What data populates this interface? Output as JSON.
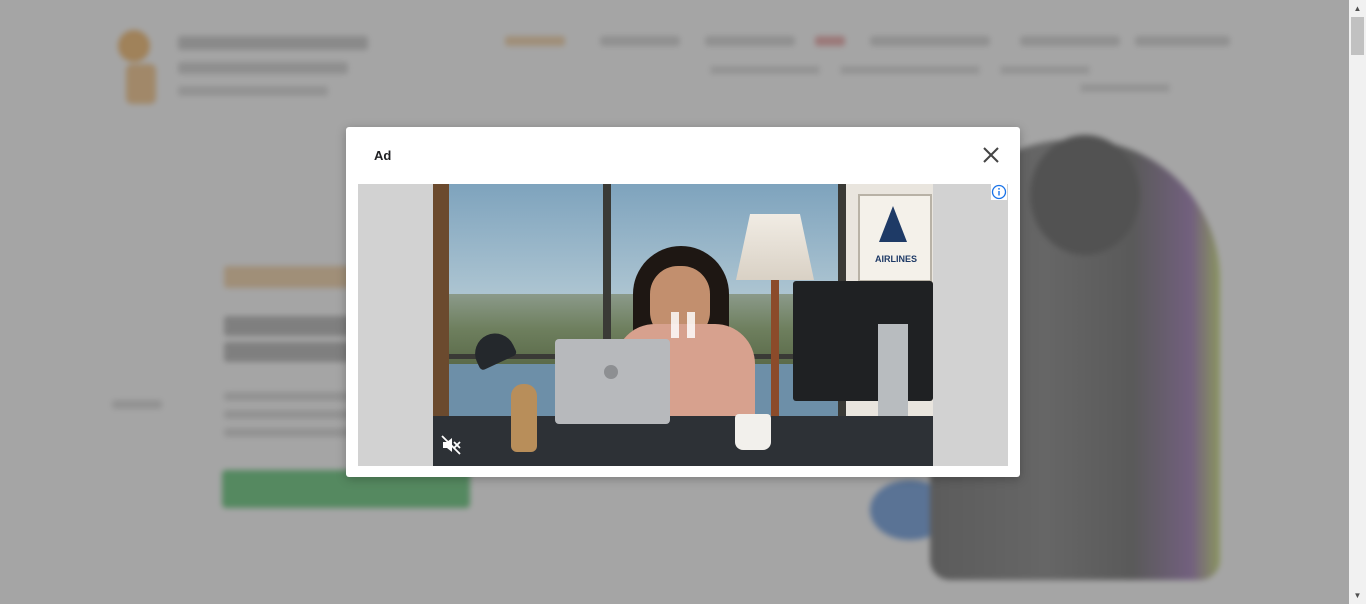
{
  "modal": {
    "title": "Ad"
  },
  "ad": {
    "poster_text": "AIRLINES"
  },
  "icons": {
    "close": "close-icon",
    "info": "info-icon",
    "pause": "pause-icon",
    "mute": "volume-muted-icon",
    "scroll_up": "chevron-up-icon",
    "scroll_down": "chevron-down-icon"
  },
  "colors": {
    "overlay": "#6e6e6e",
    "ad_info_blue": "#1a73e8",
    "cta_green": "#2db54b",
    "accent_orange": "#f1a23a"
  }
}
